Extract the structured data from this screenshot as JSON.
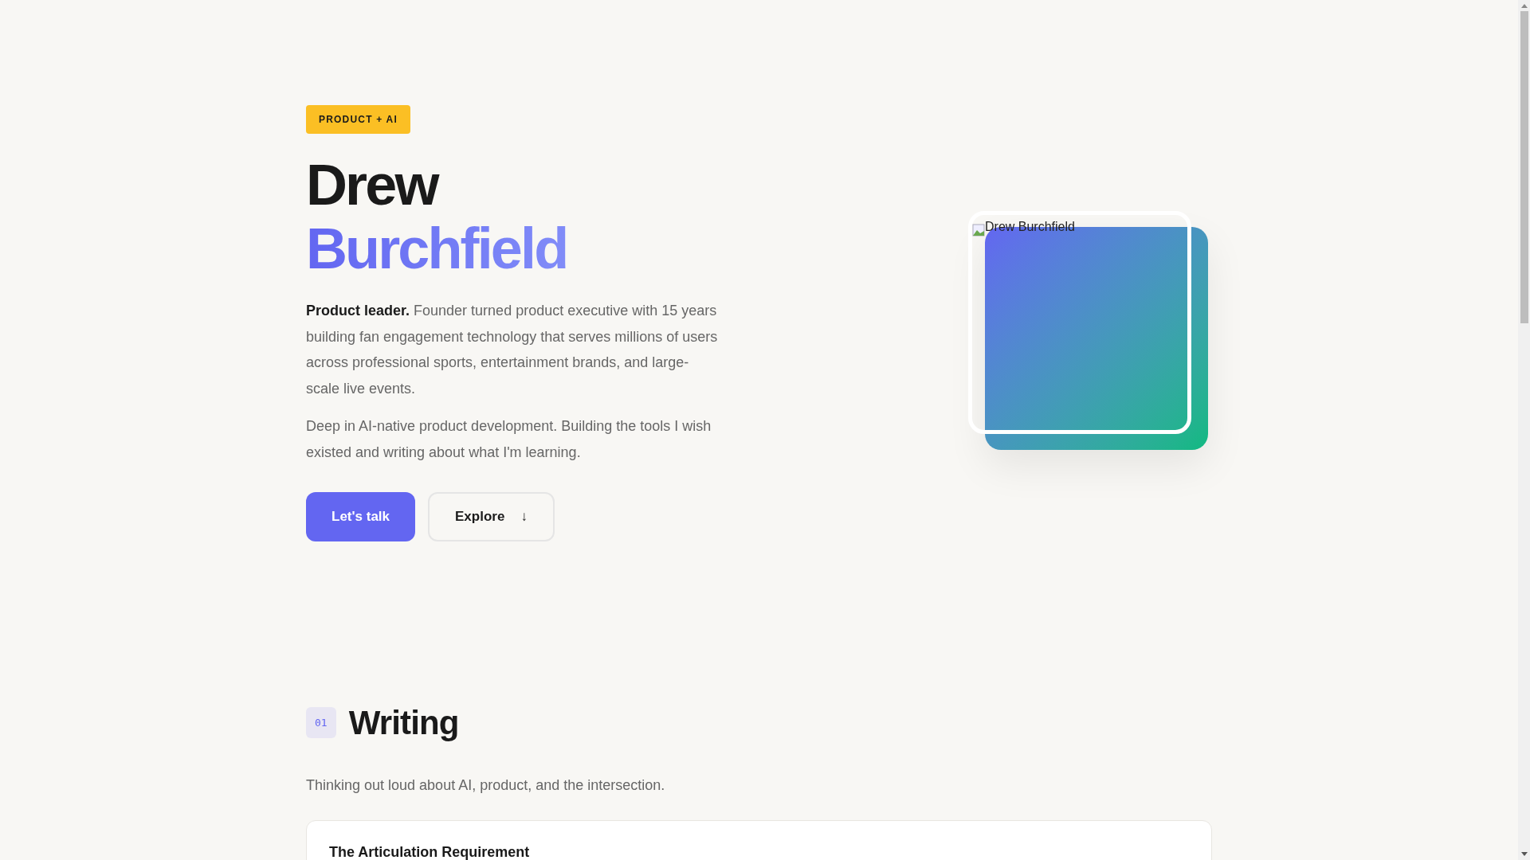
{
  "hero": {
    "badge": "PRODUCT + AI",
    "first_name": "Drew",
    "last_name": "Burchfield",
    "intro_lead": "Product leader.",
    "intro": "Founder turned product executive with 15 years building fan engagement technology that serves millions of users across professional sports, entertainment brands, and large-scale live events.",
    "intro_2": "Deep in AI-native product development. Building the tools I wish existed and writing about what I'm learning.",
    "buttons": [
      {
        "kind": "primary",
        "label": "Let's talk"
      },
      {
        "kind": "secondary",
        "label": "Explore",
        "icon": "↓"
      }
    ],
    "portrait": {
      "alt": "Drew Burchfield"
    }
  },
  "writing": {
    "number": "01",
    "title": "Writing",
    "subtitle": "Thinking out loud about AI, product, and the intersection.",
    "posts": [
      {
        "title": "The Articulation Requirement"
      }
    ]
  }
}
